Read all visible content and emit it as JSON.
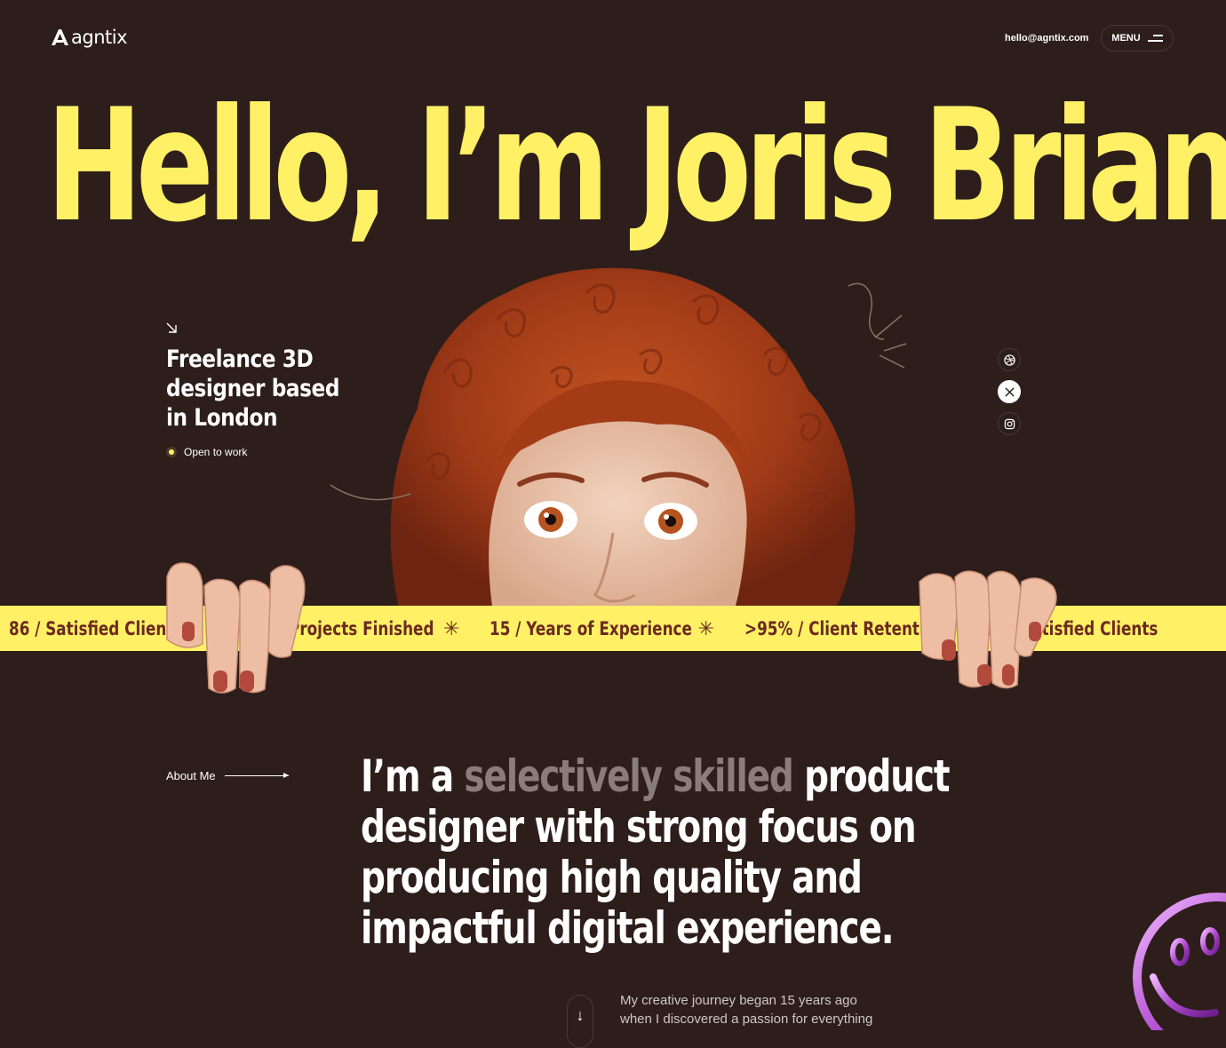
{
  "header": {
    "logo_text": "agntix",
    "email": "hello@agntix.com",
    "menu_label": "MENU"
  },
  "hero": {
    "title": "Hello, I’m Joris Brian",
    "intro_line1": "Freelance 3D",
    "intro_line2": "designer based",
    "intro_line3": "in London",
    "status": "Open to work"
  },
  "social": [
    {
      "icon": "dribbble-icon"
    },
    {
      "icon": "x-icon"
    },
    {
      "icon": "instagram-icon"
    }
  ],
  "ticker": {
    "items": [
      "86 / Satisfied Clients",
      "Projects Finished",
      "15 / Years of Experience",
      ">95% / Client Retention",
      "86 / Satisfied Clients"
    ]
  },
  "about": {
    "label": "About Me",
    "para_start": "I’m a ",
    "para_muted": "selectively skilled",
    "para_rest": " product designer with strong focus on producing high quality and impactful digital experience.",
    "journey": "My creative journey began 15 years ago when I discovered a passion for everything"
  },
  "colors": {
    "background": "#2d1e1b",
    "accent_yellow": "#fff066",
    "ticker_text": "#6b2a1f"
  }
}
